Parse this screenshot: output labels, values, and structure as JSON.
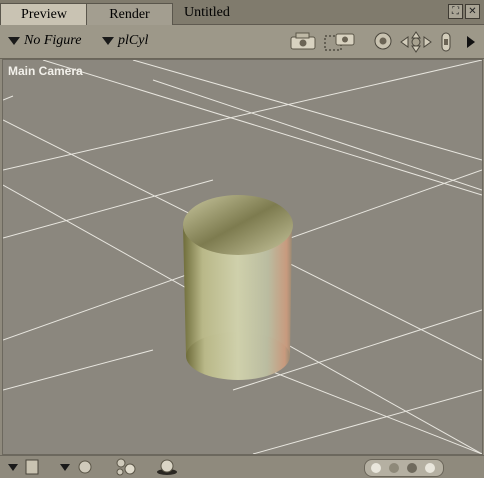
{
  "tabs": [
    {
      "label": "Preview"
    },
    {
      "label": "Render"
    }
  ],
  "document": {
    "title": "Untitled"
  },
  "toolbar": {
    "figure_select": "No Figure",
    "actor_select": "plCyl"
  },
  "viewport": {
    "camera_label": "Main Camera"
  },
  "colors": {
    "viewport_bg": "#8b877e",
    "grid_line": "#e8e6df",
    "object_tint": "#cfcfa5"
  }
}
